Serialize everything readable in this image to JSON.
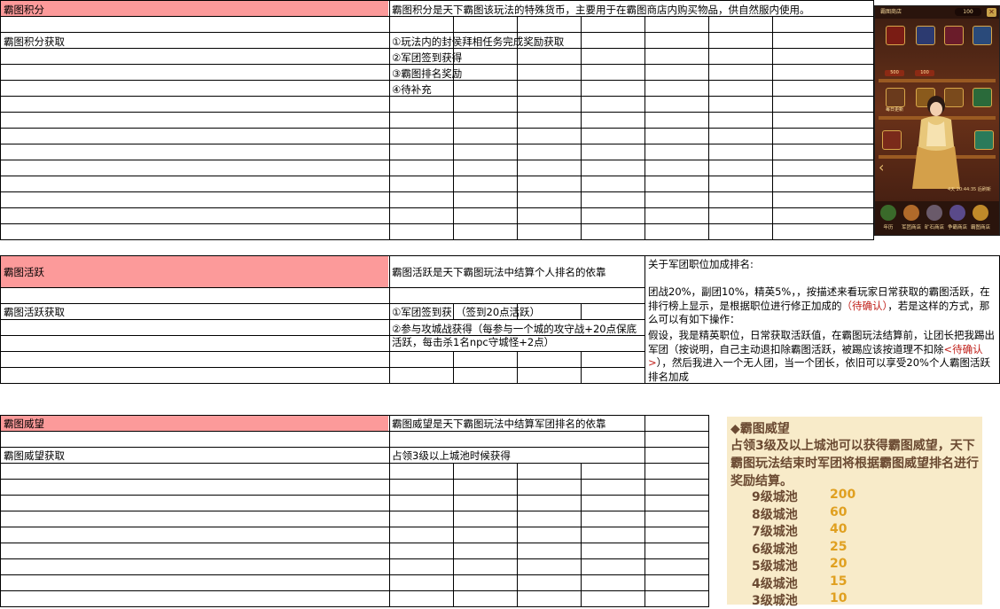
{
  "section_points": {
    "title": "霸图积分",
    "description": "霸图积分是天下霸图该玩法的特殊货币，主要用于在霸图商店内购买物品，供自然服内使用。",
    "acquire_label": "霸图积分获取",
    "acquire_items": [
      "①玩法内的封侯拜相任务完成奖励获取",
      "②军团签到获得",
      "③霸图排名奖励",
      "④待补充"
    ]
  },
  "section_active": {
    "title": "霸图活跃",
    "description": "霸图活跃是天下霸图玩法中结算个人排名的依靠",
    "acquire_label": "霸图活跃获取",
    "acquire_items": [
      "①军团签到获",
      "（签到20点活跃）",
      "②参与攻城战获得（每参与一个城的攻守战+20点保底活跃，每击杀1名npc守城怪+2点）"
    ],
    "note_title": "关于军团职位加成排名:",
    "note_p1": "团战20%，副团10%，精英5%，，按描述来看玩家日常获取的霸图活跃，在排行榜上显示，是根据职位进行修正加成的",
    "note_p1_red": "（待确认）",
    "note_p1_tail": "，若是这样的方式，那么可以有如下操作：",
    "note_p2": "假设，我是精英职位，日常获取活跃值，在霸图玩法结算前，让团长把我踢出军团（按说明，自己主动退扣除霸图活跃，被踢应该按道理不扣除",
    "note_p2_red": "<待确认>",
    "note_p2_tail": "），然后我进入一个无人团，当一个团长，依旧可以享受20%个人霸图活跃排名加成"
  },
  "section_prestige": {
    "title": "霸图威望",
    "description": "霸图威望是天下霸图玩法中结算军团排名的依靠",
    "acquire_label": "霸图威望获取",
    "acquire_items": [
      "占领3级以上城池时候获得"
    ],
    "panel": {
      "title": "◆霸图威望",
      "desc": "占领3级及以上城池可以获得霸图威望，天下霸图玩法结束时军团将根据霸图威望排名进行奖励结算。",
      "rows": [
        {
          "label": "9级城池",
          "value": "200"
        },
        {
          "label": "8级城池",
          "value": "60"
        },
        {
          "label": "7级城池",
          "value": "40"
        },
        {
          "label": "6级城池",
          "value": "25"
        },
        {
          "label": "5级城池",
          "value": "20"
        },
        {
          "label": "4级城池",
          "value": "15"
        },
        {
          "label": "3级城池",
          "value": "10"
        }
      ]
    }
  },
  "shop_screenshot": {
    "title": "霸图商店",
    "currency": "100",
    "close": "✕",
    "prices": [
      "500",
      "100"
    ],
    "tab_labels": [
      "年历",
      "军团商店",
      "矿石商店",
      "争霸商店",
      "霸图商店"
    ],
    "footer": "4天 20:44:35 后刷新",
    "tag": "每日更新"
  },
  "colors": {
    "header_pink": "#fc9a9a",
    "grid": "#000000",
    "panel_bg": "#f8ebc9",
    "panel_text": "#6b4a32",
    "panel_value": "#e0a020",
    "confirm_red": "#c0201a"
  }
}
